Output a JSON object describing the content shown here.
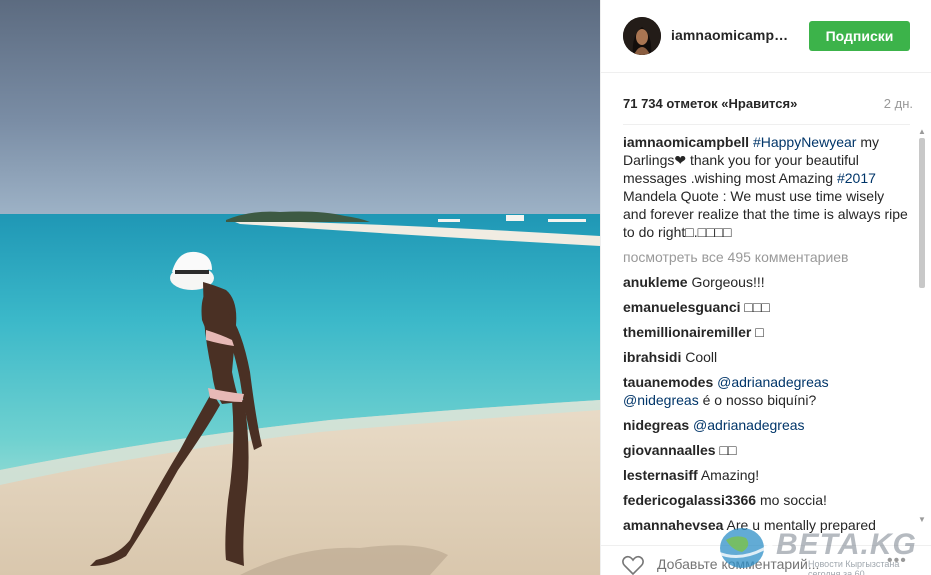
{
  "post": {
    "username": "iamnaomicamp…",
    "follow_label": "Подписки",
    "likes": "71 734 отметок «Нравится»",
    "time": "2 дн."
  },
  "caption": {
    "user": "iamnaomicampbell",
    "tag1": "#HappyNewyear",
    "text1": " my Darlings❤ thank you for your beautiful messages .wishing most Amazing ",
    "tag2": "#2017",
    "text2": " Mandela Quote : We must use time wisely and forever realize that the time is always ripe to do right□.□□□□"
  },
  "view_all": "посмотреть все 495 комментариев",
  "comments": [
    {
      "user": "anukleme",
      "text": "Gorgeous!!!"
    },
    {
      "user": "emanuelesguanci",
      "text": "□□□"
    },
    {
      "user": "themillionairemiller",
      "text": "□"
    },
    {
      "user": "ibrahsidi",
      "text": "Cooll"
    },
    {
      "user": "tauanemodes",
      "tag": "@adrianadegreas",
      "tag2": "@nidegreas",
      "text": " é o nosso biquíni?"
    },
    {
      "user": "nidegreas",
      "tag": "@adrianadegreas"
    },
    {
      "user": "giovannaalles",
      "text": "□□"
    },
    {
      "user": "lesternasiff",
      "text": "Amazing!"
    },
    {
      "user": "federicogalassi3366",
      "text": "mo soccia!"
    },
    {
      "user": "amannahevsea",
      "text": "Are u mentally prepared"
    }
  ],
  "add_comment_placeholder": "Добавьте комментарий...",
  "watermark": {
    "text": "ВЕТА.KG",
    "sub": "Новости Кыргызстана сегодня за 60"
  },
  "icons": {
    "like": "heart-icon",
    "more": "more-dots-icon",
    "scroll_up": "scroll-up-arrow-icon",
    "scroll_down": "scroll-down-arrow-icon"
  },
  "colors": {
    "follow_button": "#3cb34a",
    "hashtag": "#003569",
    "muted": "#999999"
  }
}
